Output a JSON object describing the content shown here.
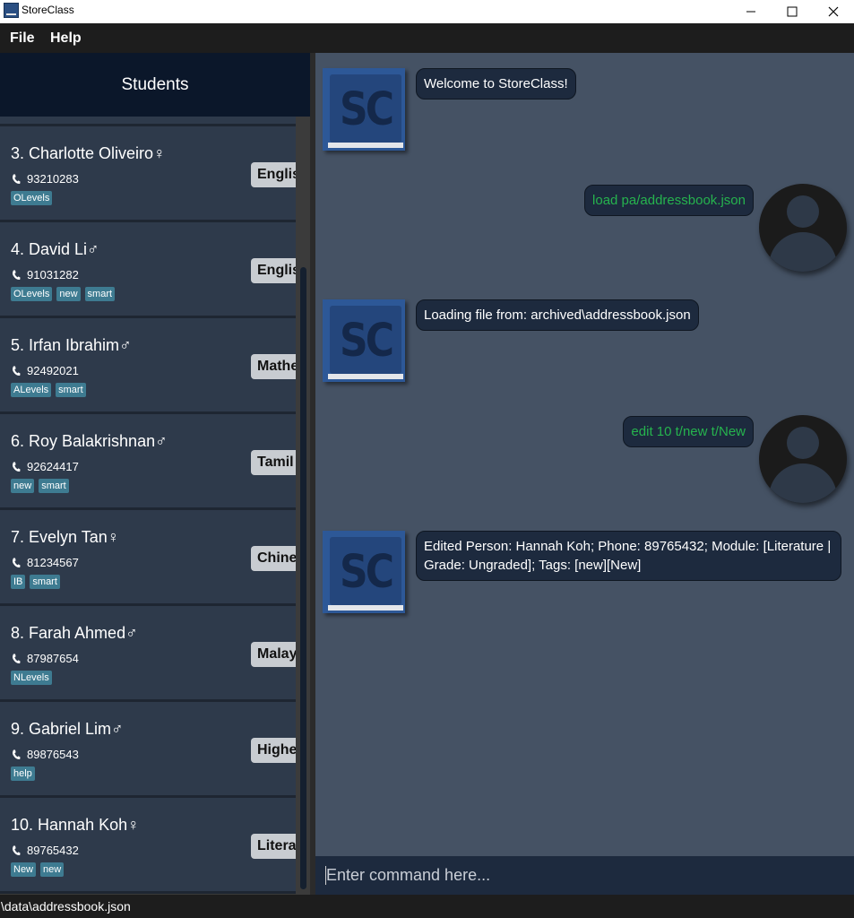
{
  "window": {
    "title": "StoreClass",
    "icon": "storeclass-app-icon",
    "controls": [
      "minimize-icon",
      "maximize-icon",
      "close-icon"
    ]
  },
  "menu": {
    "file": "File",
    "help": "Help"
  },
  "list": {
    "header": "Students",
    "students": [
      {
        "name": "3. Charlotte Oliveiro",
        "gender": "♀",
        "phone": "93210283",
        "tags": [
          "OLevels"
        ],
        "module": "English"
      },
      {
        "name": "4. David Li",
        "gender": "♂",
        "phone": "91031282",
        "tags": [
          "OLevels",
          "new",
          "smart"
        ],
        "module": "English"
      },
      {
        "name": "5. Irfan Ibrahim",
        "gender": "♂",
        "phone": "92492021",
        "tags": [
          "ALevels",
          "smart"
        ],
        "module": "Mathematics"
      },
      {
        "name": "6. Roy Balakrishnan",
        "gender": "♂",
        "phone": "92624417",
        "tags": [
          "new",
          "smart"
        ],
        "module": "Tamil"
      },
      {
        "name": "7. Evelyn Tan",
        "gender": "♀",
        "phone": "81234567",
        "tags": [
          "IB",
          "smart"
        ],
        "module": "Chinese"
      },
      {
        "name": "8. Farah Ahmed",
        "gender": "♂",
        "phone": "87987654",
        "tags": [
          "NLevels"
        ],
        "module": "Malay"
      },
      {
        "name": "9. Gabriel Lim",
        "gender": "♂",
        "phone": "89876543",
        "tags": [
          "help"
        ],
        "module": "Higher"
      },
      {
        "name": "10. Hannah Koh",
        "gender": "♀",
        "phone": "89765432",
        "tags": [
          "New",
          "new"
        ],
        "module": "Literature"
      }
    ]
  },
  "chat": {
    "messages": [
      {
        "from": "bot",
        "text": "Welcome to StoreClass!"
      },
      {
        "from": "user",
        "text": "load pa/addressbook.json"
      },
      {
        "from": "bot",
        "text": "Loading file from: archived\\addressbook.json"
      },
      {
        "from": "user",
        "text": "edit 10 t/new t/New"
      },
      {
        "from": "bot",
        "text": "Edited Person: Hannah Koh; Phone: 89765432; Module: [Literature | Grade: Ungraded]; Tags: [new][New]"
      }
    ],
    "bot_avatar_text": "SC"
  },
  "command": {
    "placeholder": "Enter command here..."
  },
  "status": {
    "path": "\\data\\addressbook.json"
  },
  "colors": {
    "header_bg": "#0b172a",
    "card_bg": "#2e3a4b",
    "tag_bg": "#3e7b91",
    "chat_bg": "#455264",
    "bubble_bg": "#1d2a3e",
    "user_text": "#26b34e"
  }
}
